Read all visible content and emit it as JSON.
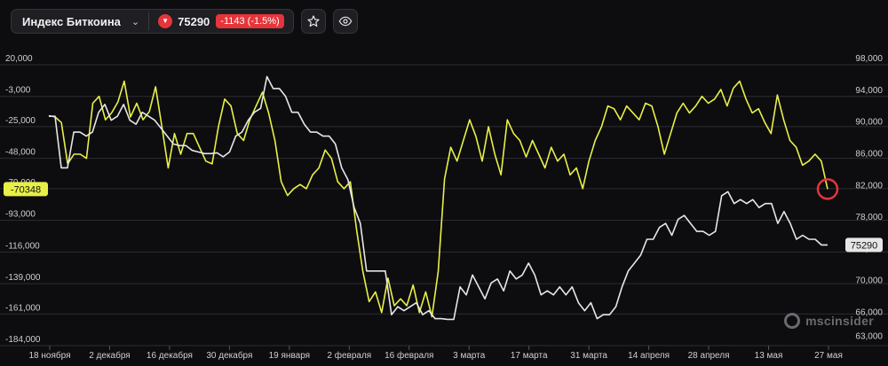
{
  "header": {
    "index_name": "Индекс Биткоина",
    "price": "75290",
    "change": "-1143 (-1.5%)"
  },
  "watermark": "mscinsider",
  "colors": {
    "yellow": "#e8f046",
    "white": "#e6e6e6",
    "red": "#e5353b",
    "grid": "#2c2c32"
  },
  "chart_data": {
    "type": "line",
    "x_labels": [
      "18 ноября",
      "2 декабря",
      "16 декабря",
      "30 декабря",
      "19 января",
      "2 февраля",
      "16 февраля",
      "3 марта",
      "17 марта",
      "31 марта",
      "14 апреля",
      "28 апреля",
      "13 мая",
      "27 мая"
    ],
    "left_axis": {
      "ticks": [
        "20,000",
        "-3,000",
        "-25,000",
        "-48,000",
        "-70,000",
        "-93,000",
        "-116,000",
        "-139,000",
        "-161,000",
        "-184,000"
      ],
      "min": -184000,
      "max": 20000
    },
    "right_axis": {
      "ticks": [
        "98,000",
        "94,000",
        "90,000",
        "86,000",
        "82,000",
        "78,000",
        "74,000",
        "70,000",
        "66,000",
        "63,000"
      ],
      "min": 62600,
      "max": 98000
    },
    "left_marker": "-70348",
    "right_marker": "75290",
    "series": [
      {
        "axis": "left",
        "color": "#e8f046",
        "values": [
          -17000,
          -18000,
          -22000,
          -52000,
          -45000,
          -45000,
          -48000,
          -8000,
          -3000,
          -20000,
          -15000,
          -7000,
          8000,
          -18000,
          -8000,
          -20000,
          -14000,
          4000,
          -25000,
          -55000,
          -30000,
          -45000,
          -30000,
          -30000,
          -40000,
          -50000,
          -52000,
          -25000,
          -5000,
          -10000,
          -30000,
          -35000,
          -20000,
          -10000,
          0,
          -15000,
          -35000,
          -65000,
          -75000,
          -70000,
          -67000,
          -70000,
          -60000,
          -55000,
          -42000,
          -48000,
          -65000,
          -70000,
          -65000,
          -100000,
          -130000,
          -152000,
          -145000,
          -160000,
          -135000,
          -155000,
          -150000,
          -155000,
          -140000,
          -160000,
          -145000,
          -163000,
          -130000,
          -63000,
          -40000,
          -50000,
          -35000,
          -20000,
          -32000,
          -50000,
          -25000,
          -45000,
          -60000,
          -20000,
          -30000,
          -35000,
          -47000,
          -35000,
          -45000,
          -55000,
          -40000,
          -50000,
          -45000,
          -60000,
          -55000,
          -70000,
          -50000,
          -35000,
          -25000,
          -10000,
          -12000,
          -20000,
          -10000,
          -15000,
          -20000,
          -8000,
          -10000,
          -25000,
          -45000,
          -30000,
          -15000,
          -8000,
          -15000,
          -10000,
          -3000,
          -8000,
          -5000,
          2000,
          -10000,
          3000,
          8000,
          -5000,
          -15000,
          -12000,
          -22000,
          -30000,
          -2000,
          -20000,
          -35000,
          -40000,
          -53000,
          -50000,
          -45000,
          -50000,
          -70348
        ]
      },
      {
        "axis": "right",
        "color": "#e6e6e6",
        "values": [
          91500,
          91500,
          85000,
          85000,
          89500,
          89500,
          89000,
          89500,
          92000,
          93000,
          91000,
          91500,
          93000,
          91000,
          90500,
          92000,
          91500,
          91000,
          90000,
          89000,
          88000,
          87800,
          87800,
          87200,
          87000,
          86800,
          86800,
          86900,
          86400,
          87000,
          89000,
          89500,
          91000,
          92000,
          92500,
          96500,
          95000,
          95000,
          94000,
          92000,
          92000,
          90500,
          89500,
          89500,
          89000,
          89000,
          88000,
          85000,
          83500,
          80000,
          78000,
          72000,
          72000,
          72000,
          72000,
          66500,
          67500,
          67000,
          67500,
          68000,
          66500,
          67000,
          66000,
          66000,
          65900,
          65900,
          70000,
          69000,
          71500,
          70000,
          68500,
          70500,
          71000,
          69500,
          72000,
          71000,
          71500,
          73000,
          71500,
          69000,
          69500,
          69000,
          70000,
          69000,
          70000,
          68000,
          67000,
          68000,
          66000,
          66500,
          66500,
          67500,
          70000,
          72000,
          73000,
          74000,
          76000,
          76000,
          77500,
          78000,
          76500,
          78500,
          79000,
          78000,
          77000,
          77000,
          76500,
          77000,
          81500,
          82000,
          80500,
          81000,
          80500,
          81000,
          80000,
          80500,
          80500,
          78000,
          79500,
          78000,
          76000,
          76500,
          76000,
          76000,
          75290,
          75290
        ]
      }
    ]
  }
}
